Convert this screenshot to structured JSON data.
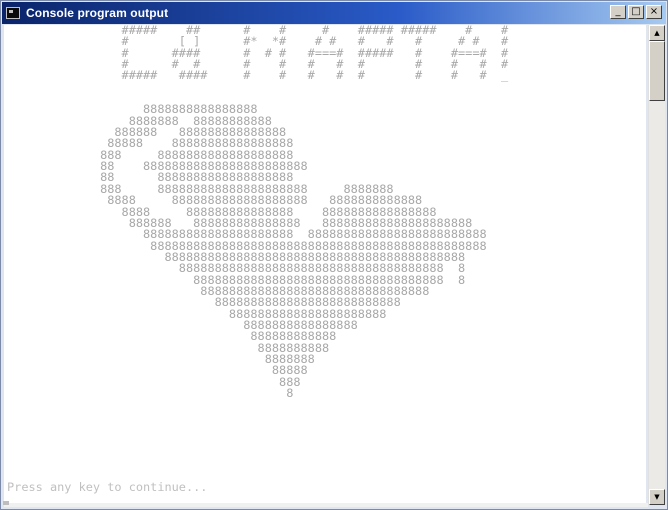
{
  "window": {
    "title": "Console program output"
  },
  "title_buttons": {
    "minimize": "_",
    "maximize": "□",
    "close": "×"
  },
  "console": {
    "output": "                #####    ##      #    #     #    ##### #####    #    #\n                #       [ ]      #*  *#    # #   #   #   #     # #   #\n                #      ####      #  # #   #===#  #####   #    #===#  #\n                #      #  #      #    #   #   #  #       #    #   #  #\n                #####   ####     #    #   #   #  #       #    #   #  _\n\n\n                   8888888888888888\n                 8888888  88888888888\n               888888   888888888888888\n              88888    88888888888888888\n             888     8888888888888888888\n             88    88888888888888888888888\n             88      8888888888888888888\n             888     888888888888888888888     8888888\n              8888     8888888888888888888   8888888888888\n                8888     888888888888888    8888888888888888\n                 888888   888888888888888   888888888888888888888\n                   888888888888888888888  8888888888888888888888888\n                    88888888888888888888888888888888888888888888888\n                      888888888888888888888888888888888888888888\n                        8888888888888888888888888888888888888  8\n                          88888888888888888888888888888888888  8\n                           88888888888888888888888888888888\n                             88888888888888888888888888\n                               8888888888888888888888\n                                 8888888888888888\n                                  888888888888\n                                   8888888888\n                                    8888888\n                                     88888\n                                      888\n                                       8",
    "prompt": "Press any key to continue..."
  },
  "scrollbar": {
    "up_arrow": "▲",
    "down_arrow": "▼"
  }
}
